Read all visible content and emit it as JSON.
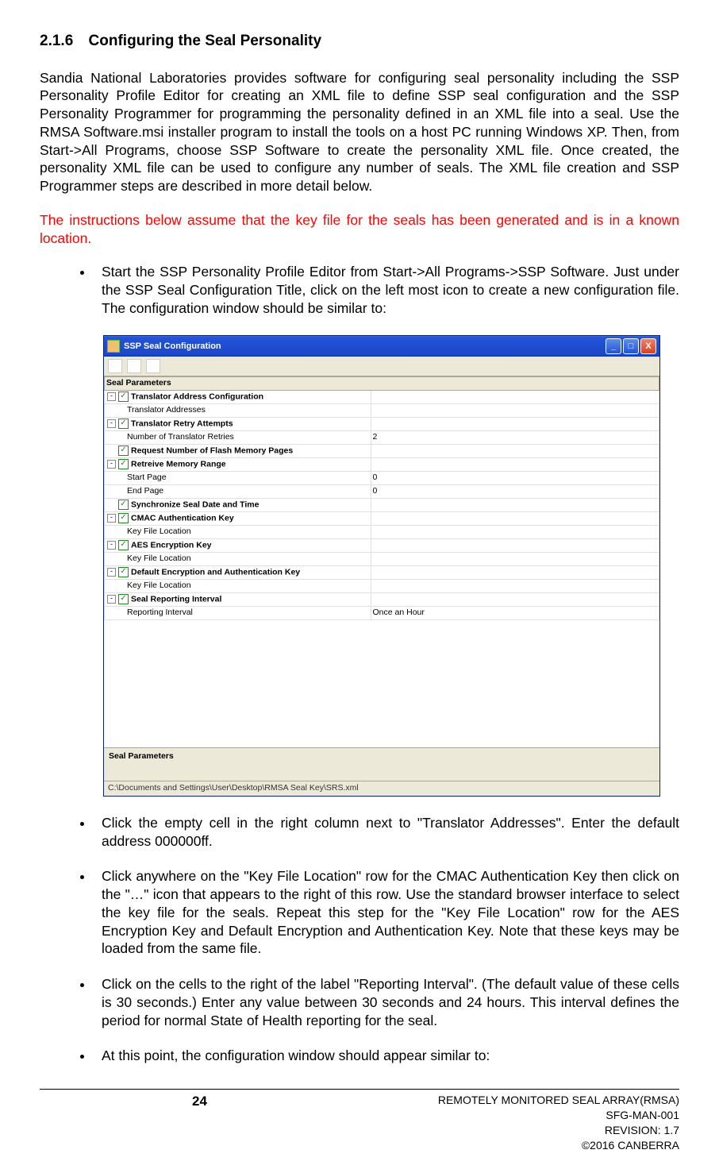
{
  "heading": {
    "number": "2.1.6",
    "title": "Configuring the Seal Personality"
  },
  "para1": "Sandia National Laboratories provides software for configuring seal personality including the SSP Personality Profile Editor for creating an XML file to define SSP seal configuration and the SSP Personality Programmer for programming the personality defined in an XML file into a seal.  Use the RMSA Software.msi installer program to install the tools on a host PC running Windows XP.  Then, from Start->All Programs, choose SSP Software to create the personality XML file.  Once created, the personality XML file can be used to configure any number of seals.  The XML file creation and SSP Programmer steps are described in more detail below.",
  "red_note": "The instructions below assume that the key file for the seals has been generated and is in a known location.",
  "bullet1": "Start the SSP Personality Profile Editor from Start->All Programs->SSP Software.  Just under the SSP Seal Configuration Title, click on the left most icon to create a new configuration file.  The configuration window should be similar to:",
  "bullet2": "Click the empty cell in the right column next to \"Translator Addresses\".  Enter the default address 000000ff.",
  "bullet3": "Click anywhere on the \"Key File Location\" row for the CMAC Authentication Key then click on the \"…\" icon that appears to the right of this row.  Use the standard browser interface to select the key file for the seals.  Repeat this step for the \"Key File Location\" row for the AES Encryption Key and Default Encryption and Authentication Key.  Note that these keys may be loaded from the same file.",
  "bullet4": "Click on the cells to the right of the label \"Reporting Interval\".  (The default value of these cells is 30 seconds.)  Enter any value between 30 seconds and 24 hours.  This interval defines the period for normal State of Health reporting for the seal.",
  "bullet5": "At this point, the configuration window should appear similar to:",
  "window": {
    "title": "SSP Seal Configuration",
    "min": "_",
    "max": "□",
    "close": "X",
    "rows": {
      "r0": "Seal Parameters",
      "r1": "Translator Address Configuration",
      "r2": "Translator Addresses",
      "r3": "Translator Retry Attempts",
      "r4": "Number of Translator Retries",
      "v4": "2",
      "r5": "Request Number of Flash Memory Pages",
      "r6": "Retreive Memory Range",
      "r7": "Start Page",
      "v7": "0",
      "r8": "End Page",
      "v8": "0",
      "r9": "Synchronize Seal Date and Time",
      "r10": "CMAC Authentication Key",
      "r11": "Key File Location",
      "r12": "AES Encryption Key",
      "r13": "Key File Location",
      "r14": "Default Encryption and Authentication Key",
      "r15": "Key File Location",
      "r16": "Seal Reporting Interval",
      "r17": "Reporting Interval",
      "v17": "Once an Hour"
    },
    "desc": "Seal Parameters",
    "status": "C:\\Documents and Settings\\User\\Desktop\\RMSA Seal Key\\SRS.xml"
  },
  "footer": {
    "page": "24",
    "line1": "REMOTELY MONITORED SEAL ARRAY(RMSA)",
    "line2": "SFG-MAN-001",
    "line3": "REVISION: 1.7",
    "line4": "©2016 CANBERRA"
  }
}
